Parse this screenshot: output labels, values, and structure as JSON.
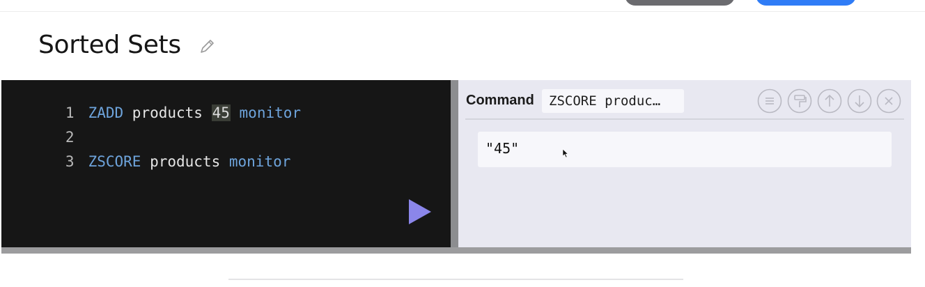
{
  "page": {
    "title": "Sorted Sets"
  },
  "editor": {
    "lines": [
      {
        "number": "1",
        "tokens": [
          "ZADD",
          " products ",
          "45",
          " monitor"
        ]
      },
      {
        "number": "2",
        "tokens": []
      },
      {
        "number": "3",
        "tokens": [
          "ZSCORE",
          " products ",
          "monitor"
        ]
      }
    ]
  },
  "results": {
    "command_label": "Command",
    "command_value": "ZSCORE produc…",
    "output": "\"45\""
  },
  "icons": {
    "edit": "pencil-icon",
    "run": "play-icon",
    "list": "list-icon",
    "format": "paint-roller-icon",
    "prev": "arrow-up-icon",
    "next": "arrow-down-icon",
    "close": "close-icon"
  },
  "colors": {
    "editor_bg": "#161616",
    "keyword": "#6ea4dc",
    "run_button": "#8b86ea",
    "results_bg": "#e8e8f1"
  }
}
